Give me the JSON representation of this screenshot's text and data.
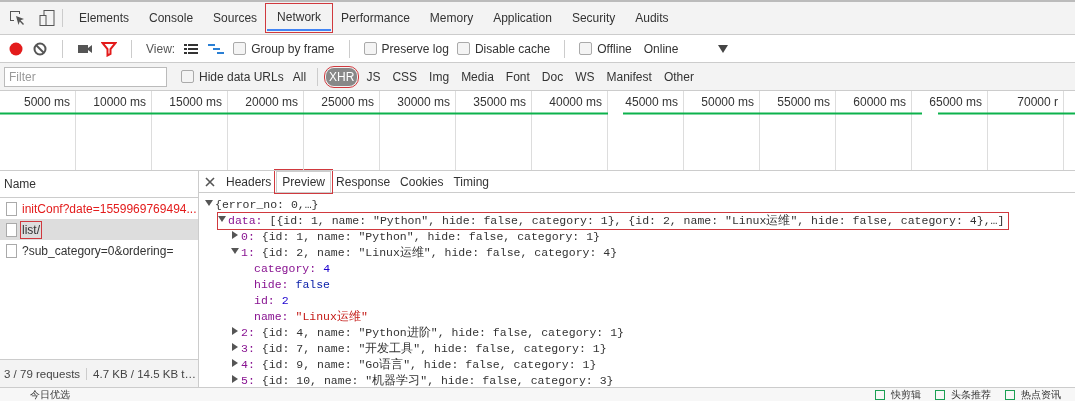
{
  "main_tabs": [
    {
      "label": "Elements",
      "selected": false,
      "highlighted": false
    },
    {
      "label": "Console",
      "selected": false,
      "highlighted": false
    },
    {
      "label": "Sources",
      "selected": false,
      "highlighted": false
    },
    {
      "label": "Network",
      "selected": true,
      "highlighted": true
    },
    {
      "label": "Performance",
      "selected": false,
      "highlighted": false
    },
    {
      "label": "Memory",
      "selected": false,
      "highlighted": false
    },
    {
      "label": "Application",
      "selected": false,
      "highlighted": false
    },
    {
      "label": "Security",
      "selected": false,
      "highlighted": false
    },
    {
      "label": "Audits",
      "selected": false,
      "highlighted": false
    }
  ],
  "toolbar": {
    "recording": true,
    "filter_on": true,
    "view_label": "View:",
    "large_rows": false,
    "overview": true,
    "checkboxes": [
      {
        "label": "Group by frame",
        "checked": false
      },
      {
        "label": "Preserve log",
        "checked": false
      },
      {
        "label": "Disable cache",
        "checked": false
      },
      {
        "label": "Offline",
        "checked": false
      }
    ],
    "throttling": "Online"
  },
  "filter_bar": {
    "placeholder": "Filter",
    "hide_data_urls": {
      "label": "Hide data URLs",
      "checked": false
    },
    "types": [
      {
        "label": "All",
        "selected": false,
        "highlighted": false
      },
      {
        "label": "XHR",
        "selected": true,
        "highlighted": true
      },
      {
        "label": "JS",
        "selected": false,
        "highlighted": false
      },
      {
        "label": "CSS",
        "selected": false,
        "highlighted": false
      },
      {
        "label": "Img",
        "selected": false,
        "highlighted": false
      },
      {
        "label": "Media",
        "selected": false,
        "highlighted": false
      },
      {
        "label": "Font",
        "selected": false,
        "highlighted": false
      },
      {
        "label": "Doc",
        "selected": false,
        "highlighted": false
      },
      {
        "label": "WS",
        "selected": false,
        "highlighted": false
      },
      {
        "label": "Manifest",
        "selected": false,
        "highlighted": false
      },
      {
        "label": "Other",
        "selected": false,
        "highlighted": false
      }
    ]
  },
  "timeline": {
    "ticks": [
      "5000 ms",
      "10000 ms",
      "15000 ms",
      "20000 ms",
      "25000 ms",
      "30000 ms",
      "35000 ms",
      "40000 ms",
      "45000 ms",
      "50000 ms",
      "55000 ms",
      "60000 ms",
      "65000 ms",
      "70000 r"
    ]
  },
  "requests": {
    "column": "Name",
    "items": [
      {
        "name": "initConf?date=1559969769494...",
        "failed": true,
        "selected": false,
        "highlighted": false
      },
      {
        "name": "list/",
        "failed": false,
        "selected": true,
        "highlighted": true
      },
      {
        "name": "?sub_category=0&ordering=",
        "failed": false,
        "selected": false,
        "highlighted": false
      }
    ],
    "summary": "3 / 79 requests",
    "transfer": "4.7 KB / 14.5 KB t…"
  },
  "detail_tabs": [
    {
      "label": "Headers",
      "selected": false,
      "highlighted": false
    },
    {
      "label": "Preview",
      "selected": true,
      "highlighted": true
    },
    {
      "label": "Response",
      "selected": false,
      "highlighted": false
    },
    {
      "label": "Cookies",
      "selected": false,
      "highlighted": false
    },
    {
      "label": "Timing",
      "selected": false,
      "highlighted": false
    }
  ],
  "preview": [
    {
      "summary": "{error_no: 0,…}",
      "expanded": true,
      "highlighted": false,
      "children": [
        {
          "key": "data:",
          "summary": "[{id: 1, name: \"Python\", hide: false, category: 1}, {id: 2, name: \"Linux运维\", hide: false, category: 4},…]",
          "expanded": true,
          "highlighted": true,
          "children": [
            {
              "key": "0:",
              "summary": "{id: 1, name: \"Python\", hide: false, category: 1}",
              "expanded": false,
              "highlighted": false
            },
            {
              "key": "1:",
              "summary": "{id: 2, name: \"Linux运维\", hide: false, category: 4}",
              "expanded": true,
              "highlighted": false,
              "children": [
                {
                  "key": "category:",
                  "value": "4",
                  "kind": "number"
                },
                {
                  "key": "hide:",
                  "value": "false",
                  "kind": "boolean"
                },
                {
                  "key": "id:",
                  "value": "2",
                  "kind": "number"
                },
                {
                  "key": "name:",
                  "value": "\"Linux运维\"",
                  "kind": "string"
                }
              ]
            },
            {
              "key": "2:",
              "summary": "{id: 4, name: \"Python进阶\", hide: false, category: 1}",
              "expanded": false,
              "highlighted": false
            },
            {
              "key": "3:",
              "summary": "{id: 7, name: \"开发工具\", hide: false, category: 1}",
              "expanded": false,
              "highlighted": false
            },
            {
              "key": "4:",
              "summary": "{id: 9, name: \"Go语言\", hide: false, category: 1}",
              "expanded": false,
              "highlighted": false
            },
            {
              "key": "5:",
              "summary": "{id: 10, name: \"机器学习\", hide: false, category: 3}",
              "expanded": false,
              "highlighted": false
            }
          ]
        }
      ]
    }
  ],
  "taskbar": {
    "left": "今日优选",
    "items": [
      "快剪辑",
      "头条推荐",
      "热点资讯"
    ]
  }
}
